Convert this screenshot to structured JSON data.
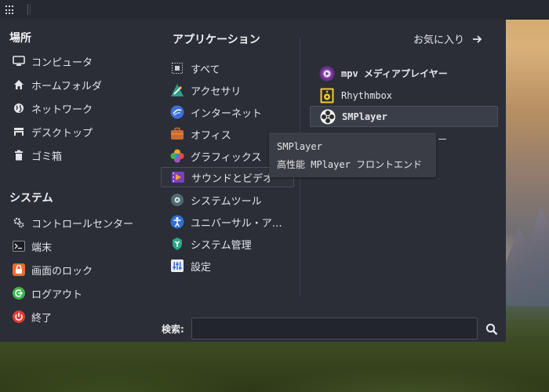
{
  "places": {
    "heading": "場所",
    "items": [
      {
        "label": "コンピュータ",
        "icon": "computer-icon"
      },
      {
        "label": "ホームフォルダ",
        "icon": "home-icon"
      },
      {
        "label": "ネットワーク",
        "icon": "network-icon"
      },
      {
        "label": "デスクトップ",
        "icon": "desktop-icon"
      },
      {
        "label": "ゴミ箱",
        "icon": "trash-icon"
      }
    ]
  },
  "system": {
    "heading": "システム",
    "items": [
      {
        "label": "コントロールセンター",
        "icon": "gear-icon"
      },
      {
        "label": "端末",
        "icon": "terminal-icon"
      },
      {
        "label": "画面のロック",
        "icon": "lock-icon"
      },
      {
        "label": "ログアウト",
        "icon": "logout-icon"
      },
      {
        "label": "終了",
        "icon": "power-icon"
      }
    ]
  },
  "applications": {
    "heading": "アプリケーション",
    "favorites_label": "お気に入り",
    "categories": [
      {
        "label": "すべて",
        "icon": "all-apps-icon"
      },
      {
        "label": "アクセサリ",
        "icon": "accessories-icon"
      },
      {
        "label": "インターネット",
        "icon": "internet-icon"
      },
      {
        "label": "オフィス",
        "icon": "office-icon"
      },
      {
        "label": "グラフィックス",
        "icon": "graphics-icon"
      },
      {
        "label": "サウンドとビデオ",
        "icon": "sound-video-icon",
        "selected": true
      },
      {
        "label": "システムツール",
        "icon": "system-tools-icon"
      },
      {
        "label": "ユニバーサル・ア…",
        "icon": "accessibility-icon"
      },
      {
        "label": "システム管理",
        "icon": "administration-icon"
      },
      {
        "label": "設定",
        "icon": "settings-icon"
      }
    ],
    "apps": [
      {
        "label": "mpv メディアプレイヤー",
        "icon": "mpv-icon",
        "bold": true
      },
      {
        "label": "Rhythmbox",
        "icon": "rhythmbox-icon"
      },
      {
        "label": "SMPlayer",
        "icon": "smplayer-icon",
        "highlighted": true
      }
    ],
    "peek_text": "ー"
  },
  "tooltip": {
    "title": "SMPlayer",
    "description": "高性能 MPlayer フロントエンド"
  },
  "search": {
    "label": "検索:",
    "value": "",
    "placeholder": ""
  },
  "colors": {
    "menu_bg": "#2b2e37",
    "panel_bg": "#262931",
    "highlight_bg": "#3a3e48"
  }
}
